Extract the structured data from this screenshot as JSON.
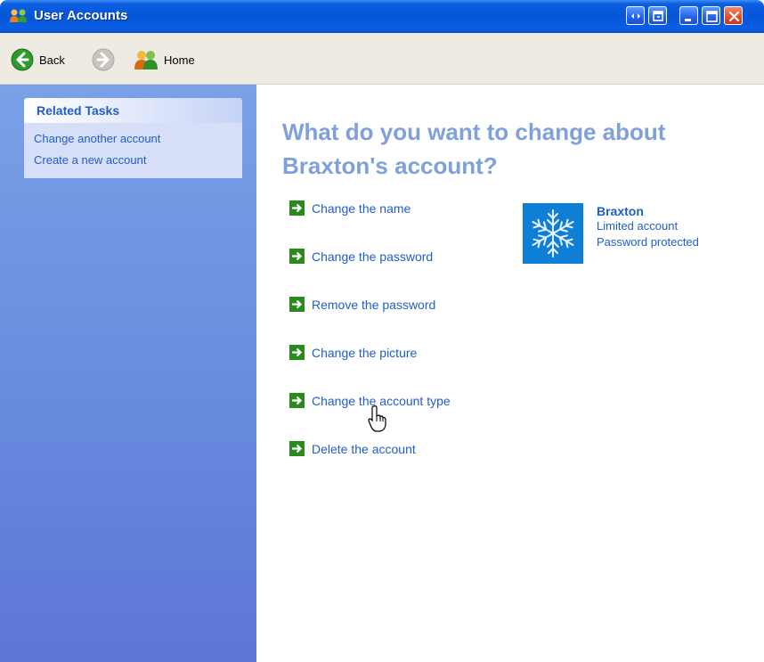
{
  "window": {
    "title": "User Accounts",
    "controls": [
      "switch-view",
      "help",
      "minimize",
      "maximize",
      "close"
    ]
  },
  "toolbar": {
    "back_label": "Back",
    "home_label": "Home"
  },
  "related_tasks": {
    "title": "Related Tasks",
    "links": [
      "Change another account",
      "Create a new account"
    ]
  },
  "main": {
    "heading_line1": "What do you want to change about",
    "heading_line2": "Braxton's account?",
    "actions": [
      "Change the name",
      "Change the password",
      "Remove the password",
      "Change the picture",
      "Change the account type",
      "Delete the account"
    ]
  },
  "account": {
    "name": "Braxton",
    "type": "Limited account",
    "status": "Password protected",
    "picture_icon": "snowflake-icon"
  },
  "colors": {
    "link": "#215dc6",
    "heading": "#7fa0db",
    "arrow_green": "#2a8a1e",
    "avatar_bg": "#0f7fd6"
  }
}
